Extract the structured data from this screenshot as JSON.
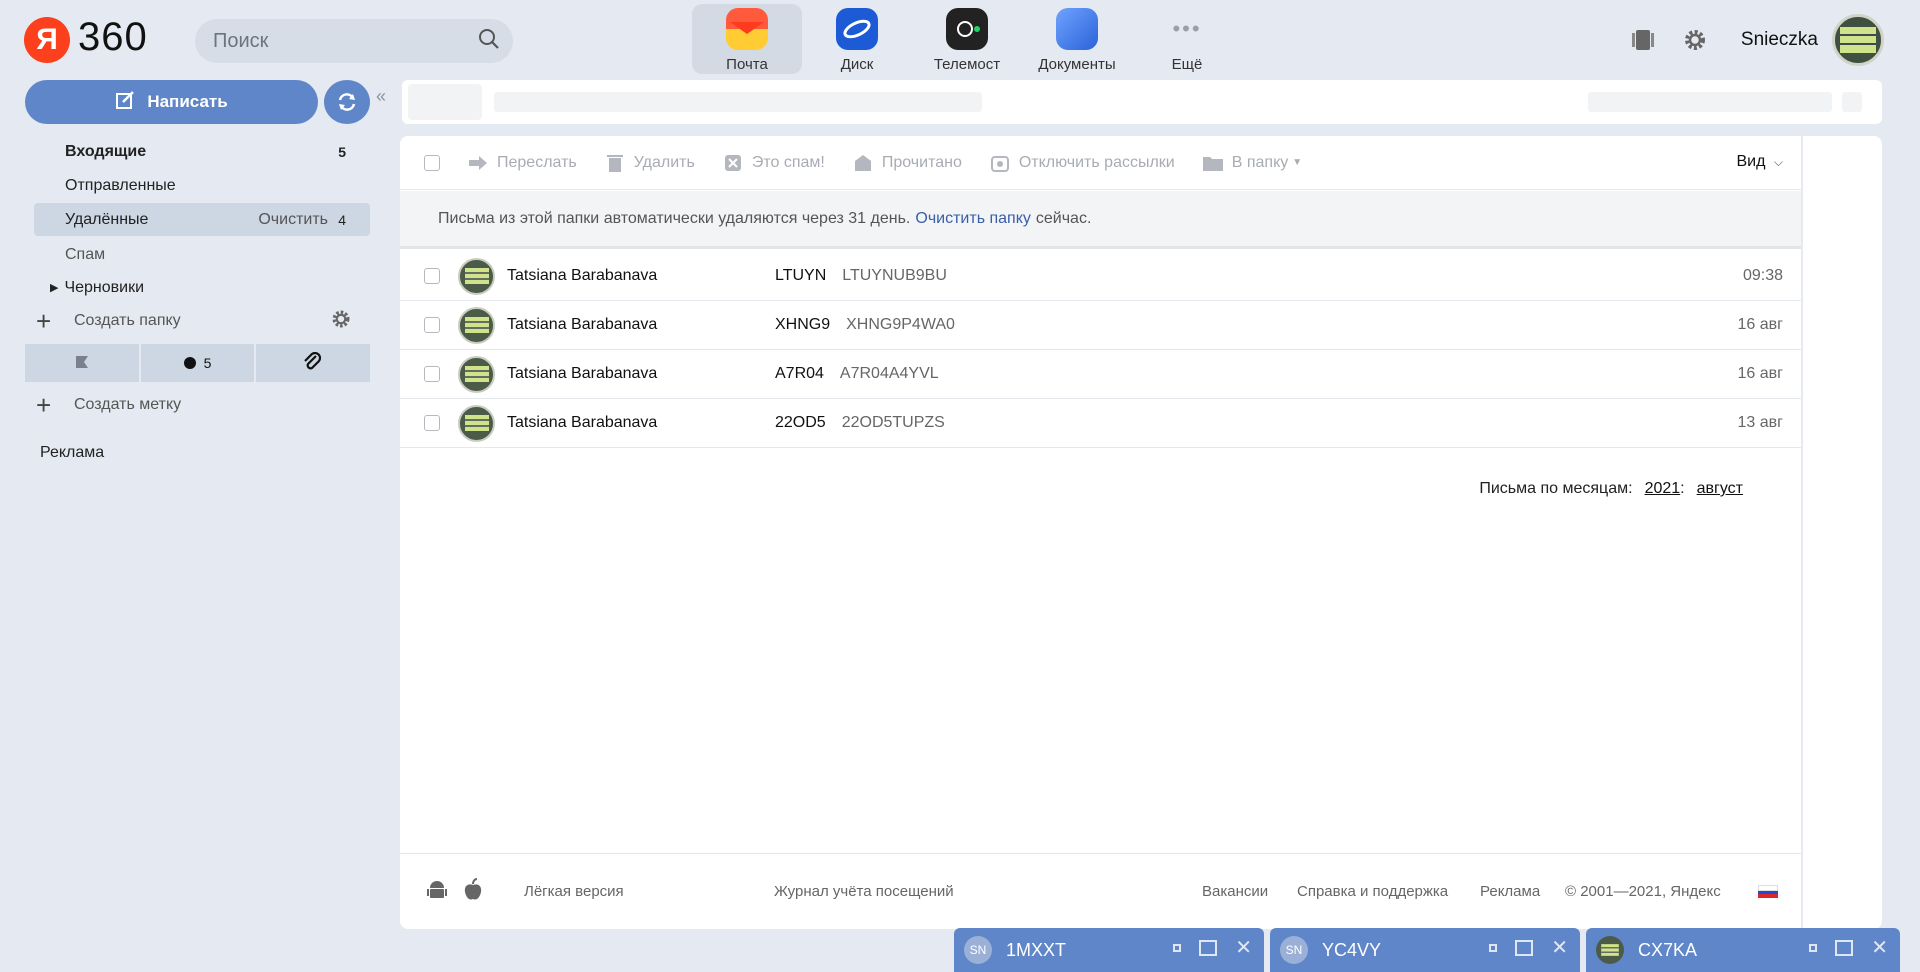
{
  "header": {
    "logo_letter": "Я",
    "logo_text": "360",
    "search_placeholder": "Поиск",
    "apps": [
      {
        "label": "Почта",
        "color": "#f54c2b"
      },
      {
        "label": "Диск",
        "color": "#1d5ad6"
      },
      {
        "label": "Телемост",
        "color": "#222222"
      },
      {
        "label": "Документы",
        "color": "#3d7ae8"
      },
      {
        "label": "Ещё",
        "color": "#9aa0a8"
      }
    ],
    "username": "Snieczka"
  },
  "compose_label": "Написать",
  "folders": [
    {
      "label": "Входящие",
      "count": "5"
    },
    {
      "label": "Отправленные"
    },
    {
      "label": "Удалённые",
      "action": "Очистить",
      "count": "4"
    },
    {
      "label": "Спам"
    },
    {
      "label": "Черновики"
    }
  ],
  "create_folder_label": "Создать папку",
  "labels_unread_count": "5",
  "create_label_label": "Создать метку",
  "ads_label": "Реклама",
  "toolbar": {
    "forward": "Переслать",
    "delete": "Удалить",
    "spam": "Это спам!",
    "read": "Прочитано",
    "unsubscribe": "Отключить рассылки",
    "to_folder": "В папку",
    "view": "Вид"
  },
  "notice": {
    "text_before": "Письма из этой папки автоматически удаляются через 31 день.",
    "link": "Очистить папку",
    "text_after": "сейчас."
  },
  "messages": [
    {
      "from": "Tatsiana Barabanava",
      "subject": "LTUYN",
      "preview": "LTUYNUB9BU",
      "date": "09:38"
    },
    {
      "from": "Tatsiana Barabanava",
      "subject": "XHNG9",
      "preview": "XHNG9P4WA0",
      "date": "16 авг"
    },
    {
      "from": "Tatsiana Barabanava",
      "subject": "A7R04",
      "preview": "A7R04A4YVL",
      "date": "16 авг"
    },
    {
      "from": "Tatsiana Barabanava",
      "subject": "22OD5",
      "preview": "22OD5TUPZS",
      "date": "13 авг"
    }
  ],
  "by_month": {
    "label": "Письма по месяцам:",
    "year": "2021",
    "month": "август"
  },
  "footer": {
    "light": "Лёгкая версия",
    "journal": "Журнал учёта посещений",
    "jobs": "Вакансии",
    "help": "Справка и поддержка",
    "ads": "Реклама",
    "copyright": "© 2001—2021, Яндекс"
  },
  "bottom_tabs": [
    {
      "initials": "SN",
      "title": "1MXXT"
    },
    {
      "initials": "SN",
      "title": "YC4VY"
    },
    {
      "initials": "",
      "title": "CX7KA"
    }
  ]
}
